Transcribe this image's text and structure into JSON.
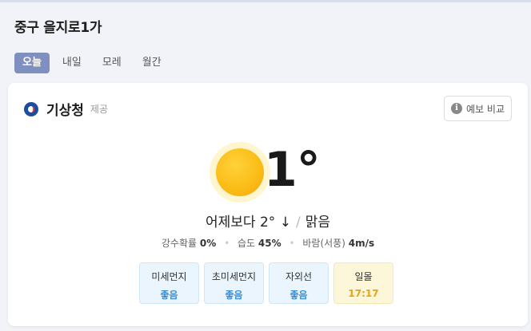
{
  "location": "중구 을지로1가",
  "tabs": [
    "오늘",
    "내일",
    "모레",
    "월간"
  ],
  "provider": {
    "name": "기상청",
    "suffix": "제공",
    "compare_label": "예보 비교"
  },
  "weather": {
    "temperature": "1°",
    "comparison": "어제보다 2° ↓",
    "condition": "맑음",
    "precip_label": "강수확률",
    "precip_value": "0%",
    "humidity_label": "습도",
    "humidity_value": "45%",
    "wind_label": "바람(서풍)",
    "wind_value": "4m/s"
  },
  "badges": [
    {
      "label": "미세먼지",
      "value": "좋음"
    },
    {
      "label": "초미세먼지",
      "value": "좋음"
    },
    {
      "label": "자외선",
      "value": "좋음"
    },
    {
      "label": "일몰",
      "value": "17:17"
    }
  ],
  "colors": {
    "tab_active": "#7f8fc0",
    "good": "#3a8fd6",
    "sunset": "#e8a316",
    "sun": "#fbbd17"
  },
  "icons": {
    "provider_logo": "kma-logo-icon",
    "compare": "info-icon",
    "condition": "sun-icon"
  }
}
